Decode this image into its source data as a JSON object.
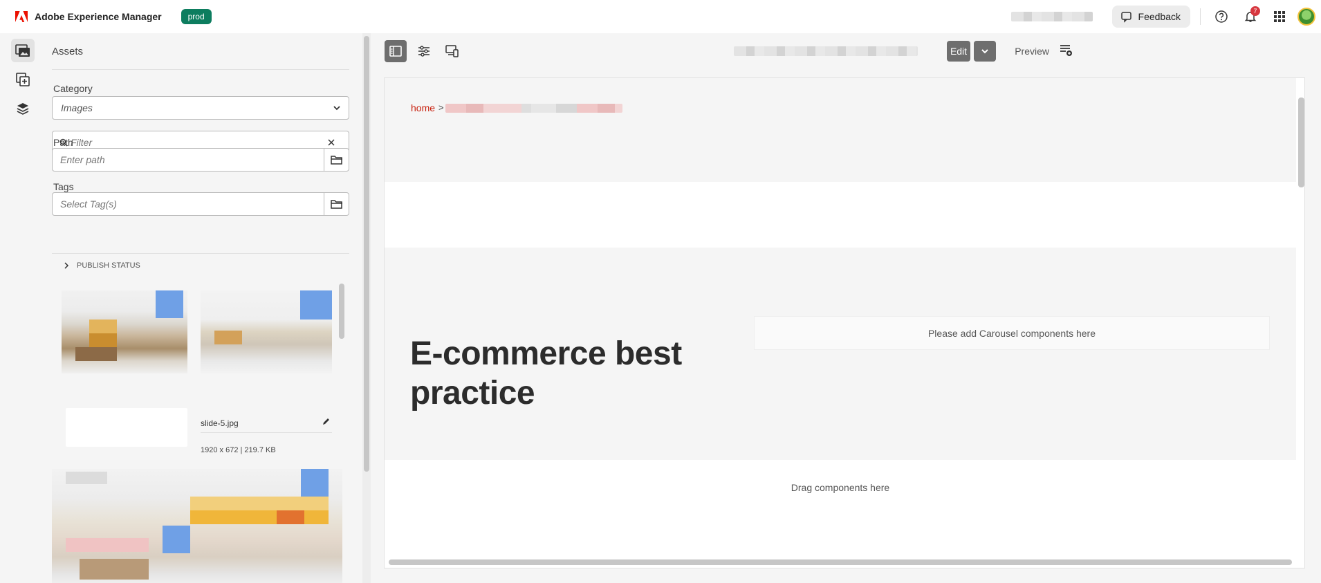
{
  "header": {
    "app_title": "Adobe Experience Manager",
    "env_badge": "prod",
    "feedback_label": "Feedback",
    "notification_count": "7",
    "icons": [
      "adobe-logo-icon",
      "feedback-icon",
      "help-icon",
      "bell-icon",
      "app-switcher-icon",
      "avatar"
    ],
    "colors": {
      "brand": "#eb1000",
      "env_badge": "#0d7d5f",
      "notification": "#d7373f"
    }
  },
  "rail": {
    "items": [
      "assets-icon",
      "components-icon",
      "content-tree-icon"
    ]
  },
  "panel": {
    "title": "Assets",
    "category_label": "Category",
    "category_value": "Images",
    "filter_placeholder": "Filter",
    "path_label": "Path",
    "path_placeholder": "Enter path",
    "tags_label": "Tags",
    "tags_placeholder": "Select Tag(s)",
    "publish_status": "PUBLISH STATUS",
    "assets": [
      {
        "name": "slide-5.jpg",
        "meta": "1920 x 672 | 219.7 KB"
      }
    ]
  },
  "toolbar": {
    "edit_label": "Edit",
    "preview_label": "Preview"
  },
  "canvas": {
    "breadcrumb_home": "home",
    "breadcrumb_separator": ">",
    "hero_title": "E-commerce best practice",
    "carousel_placeholder": "Please add Carousel components here",
    "drag_placeholder": "Drag components here"
  }
}
